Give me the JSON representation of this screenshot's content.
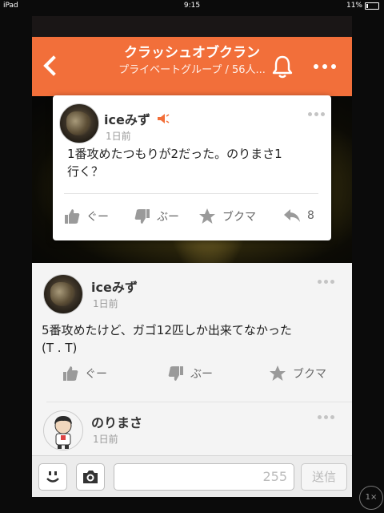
{
  "status": {
    "device": "iPad",
    "time": "9:15",
    "battery": "11%"
  },
  "header": {
    "title": "クラッシュオブクラン",
    "subtitle": "プライベートグループ / 56人..."
  },
  "floating_post": {
    "author": "iceみず",
    "time": "1日前",
    "text_line1": "1番攻めたつもりが2だった。のりまさ1",
    "text_line2": "行く？",
    "actions": {
      "like": "ぐー",
      "dislike": "ぶー",
      "bookmark": "ブクマ",
      "reply_count": "8"
    }
  },
  "post2": {
    "author": "iceみず",
    "time": "1日前",
    "text_line1": "5番攻めたけど、ガゴ12匹しか出来てなかった",
    "text_line2": "(T . T)",
    "actions": {
      "like": "ぐー",
      "dislike": "ぶー",
      "bookmark": "ブクマ"
    }
  },
  "post3": {
    "author": "のりまさ",
    "time": "1日前"
  },
  "compose": {
    "char_count": "255",
    "send_label": "送信"
  },
  "zoom": "1×",
  "colors": {
    "accent": "#f26f3a"
  }
}
